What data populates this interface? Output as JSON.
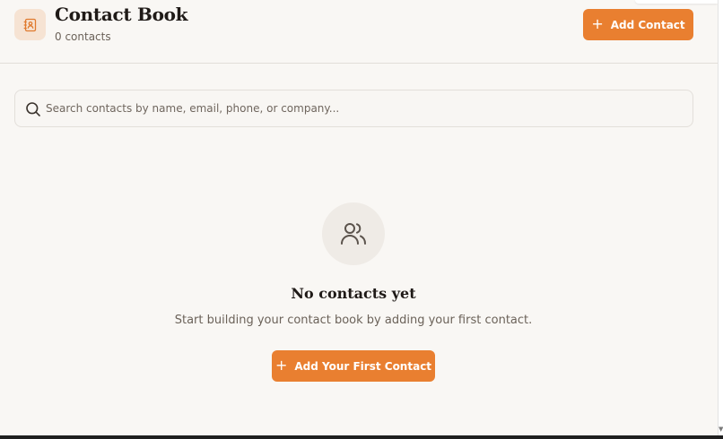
{
  "header": {
    "title": "Contact Book",
    "subtitle": "0 contacts",
    "add_button_label": "Add Contact",
    "add_button_icon": "plus-icon",
    "logo_icon": "contact-book-icon"
  },
  "search": {
    "placeholder": "Search contacts by name, email, phone, or company...",
    "value": "",
    "icon": "search-icon"
  },
  "empty_state": {
    "icon": "users-icon",
    "title": "No contacts yet",
    "description": "Start building your contact book by adding your first contact.",
    "button_label": "Add Your First Contact",
    "button_icon": "plus-icon"
  },
  "colors": {
    "accent": "#e97f30",
    "background": "#f9f7f4",
    "logo_bg": "#f6e3d3",
    "text_primary": "#1f1a17",
    "text_secondary": "#6b6259"
  }
}
